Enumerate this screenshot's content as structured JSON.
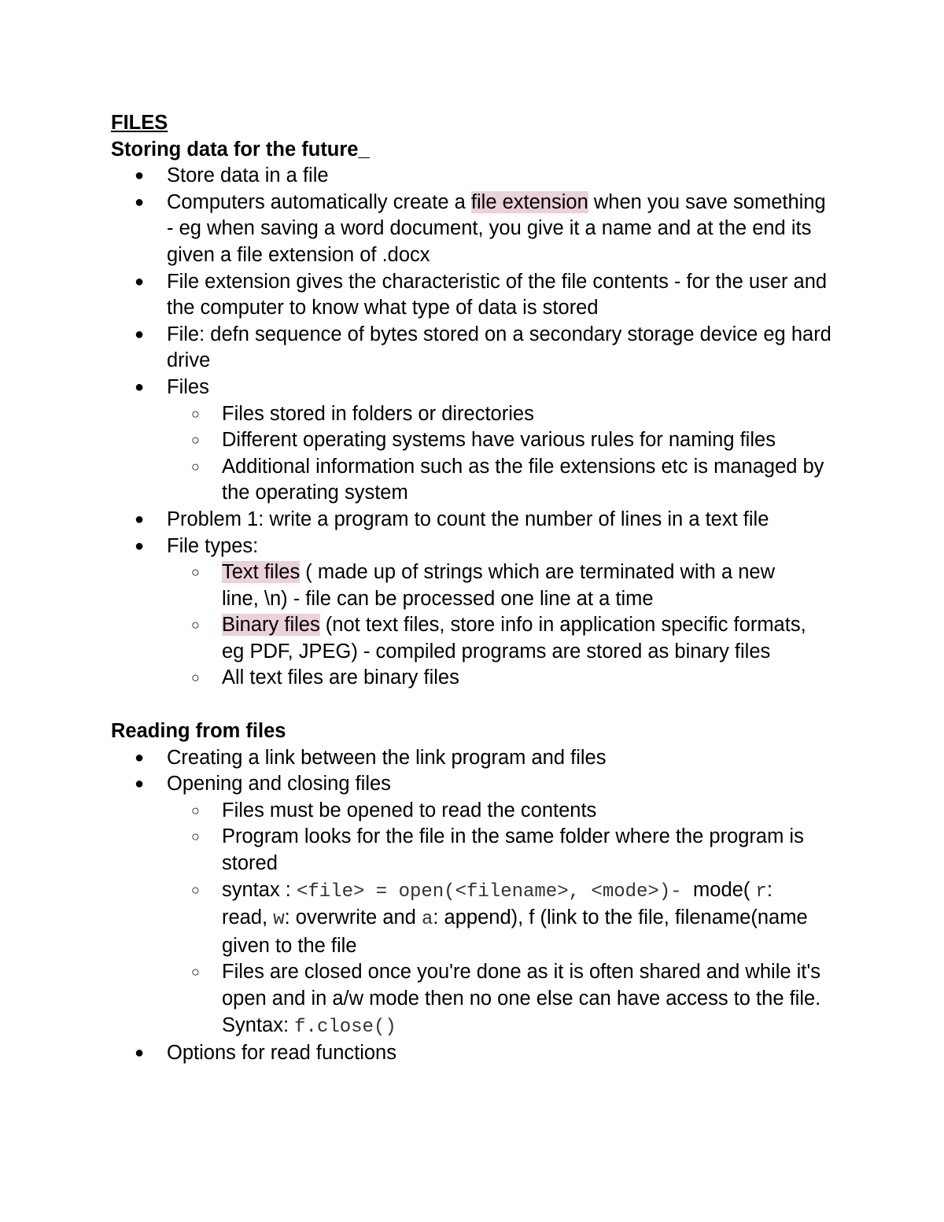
{
  "title": "FILES",
  "sections": {
    "storing": {
      "heading": "Storing data for the future_",
      "b1": "Store data in a file",
      "b2_pre": "Computers automatically create a ",
      "b2_hl": "file extension",
      "b2_post": " when you save something",
      "b2_l2": "- eg when saving a word document, you give it a name and at the end its",
      "b2_l3": "given a file extension of .docx",
      "b3_l1": "File extension gives the characteristic of the file contents - for the user and",
      "b3_l2": "the computer to know what type of data is stored",
      "b4_l1": "File: defn sequence of bytes stored on a secondary storage device eg hard",
      "b4_l2": "drive",
      "b5": "Files",
      "b5_s1": "Files stored in folders or directories",
      "b5_s2": "Different operating systems have various rules for naming files",
      "b5_s3_l1": "Additional information such as the file extensions etc is managed by",
      "b5_s3_l2": "the operating system",
      "b6": "Problem 1: write a program to count the number of lines in a text file",
      "b7": "File types:",
      "b7_s1_hl": "Text files",
      "b7_s1_post": " ( made up of strings which are terminated with a new",
      "b7_s1_l2": "line, \\n) - file can be processed one line at a time",
      "b7_s2_hl": "Binary files",
      "b7_s2_post": " (not text files, store info in application specific formats,",
      "b7_s2_l2": "eg PDF, JPEG) - compiled programs are stored as binary files",
      "b7_s3": "All text files are binary files"
    },
    "reading": {
      "heading": "Reading from files",
      "b1": "Creating a link between the link program and files",
      "b2": "Opening and closing files",
      "b2_s1": "Files must be opened to read the contents",
      "b2_s2_l1": "Program looks for the file in the same folder where the program is",
      "b2_s2_l2": "stored",
      "b2_s3_pre": "syntax : ",
      "b2_s3_code": "<file> = open(<filename>, <mode>)- ",
      "b2_s3_mid": " mode( ",
      "b2_s3_r": "r",
      "b2_s3_l2_a": ": ",
      "b2_s3_read": "read, ",
      "b2_s3_w": "w",
      "b2_s3_overwrite": ": overwrite and ",
      "b2_s3_a": "a",
      "b2_s3_rest": ": append), f (link to the file, filename(name",
      "b2_s3_l3": "given to the file",
      "b2_s4_l1": "Files are closed once you're done as it is often shared and while it's",
      "b2_s4_l2": "open and in a/w mode then no one else can have access to the file.",
      "b2_s4_l3_pre": "Syntax: ",
      "b2_s4_l3_code": "f.close()",
      "b3": "Options for read functions"
    }
  },
  "bullets": {
    "filled": "●",
    "hollow": "○"
  },
  "colors": {
    "highlight": "#ead1dc",
    "code": "#333333"
  }
}
